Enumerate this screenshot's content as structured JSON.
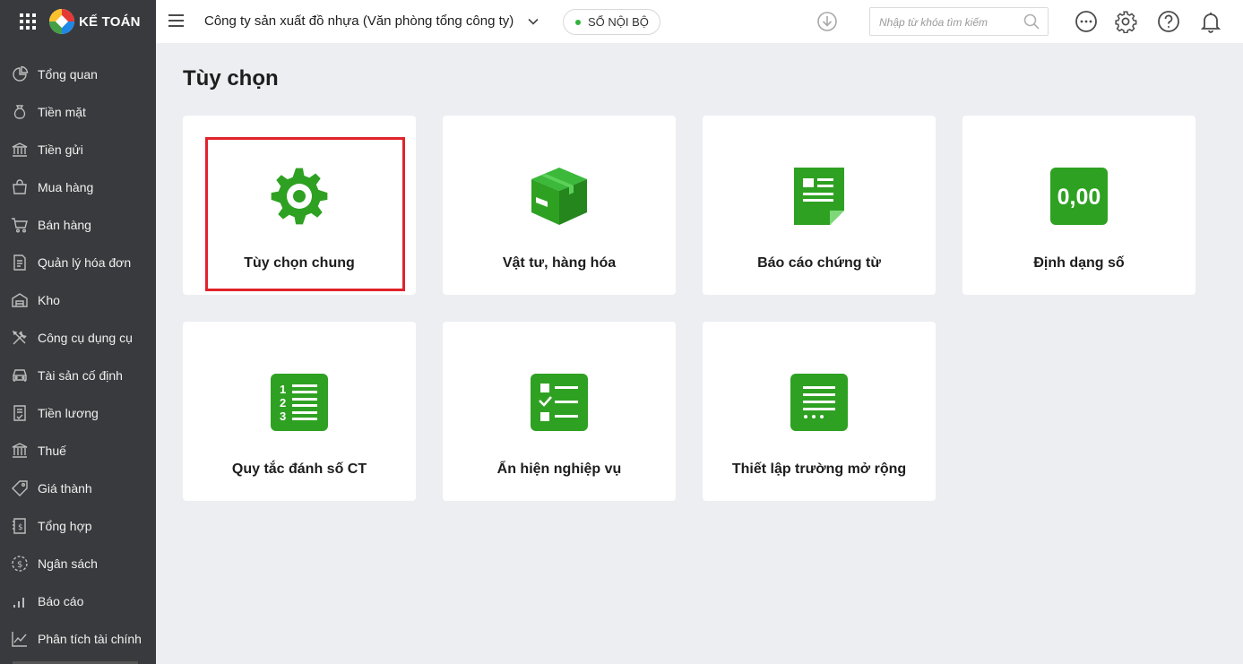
{
  "app": {
    "brand": "KẾ TOÁN"
  },
  "sidebar": {
    "items": [
      {
        "label": "Tổng quan",
        "icon": "dashboard-icon"
      },
      {
        "label": "Tiền mặt",
        "icon": "money-bag-icon"
      },
      {
        "label": "Tiền gửi",
        "icon": "bank-icon"
      },
      {
        "label": "Mua hàng",
        "icon": "shopping-bag-icon"
      },
      {
        "label": "Bán hàng",
        "icon": "cart-icon"
      },
      {
        "label": "Quản lý hóa đơn",
        "icon": "invoice-icon"
      },
      {
        "label": "Kho",
        "icon": "warehouse-icon"
      },
      {
        "label": "Công cụ dụng cụ",
        "icon": "tools-icon"
      },
      {
        "label": "Tài sản cố định",
        "icon": "car-icon"
      },
      {
        "label": "Tiền lương",
        "icon": "salary-icon"
      },
      {
        "label": "Thuế",
        "icon": "tax-building-icon"
      },
      {
        "label": "Giá thành",
        "icon": "price-tag-icon"
      },
      {
        "label": "Tổng hợp",
        "icon": "summary-book-icon"
      },
      {
        "label": "Ngân sách",
        "icon": "budget-coin-icon"
      },
      {
        "label": "Báo cáo",
        "icon": "bar-chart-icon"
      },
      {
        "label": "Phân tích tài chính",
        "icon": "trend-chart-icon"
      }
    ]
  },
  "header": {
    "company": "Công ty sản xuất đồ nhựa (Văn phòng tổng công ty)",
    "ledger": "SỔ NỘI BỘ",
    "search_placeholder": "Nhập từ khóa tìm kiếm"
  },
  "main": {
    "title": "Tùy chọn",
    "cards": [
      {
        "label": "Tùy chọn chung",
        "icon": "gear-icon",
        "selected": true
      },
      {
        "label": "Vật tư, hàng hóa",
        "icon": "box-icon"
      },
      {
        "label": "Báo cáo chứng từ",
        "icon": "document-report-icon"
      },
      {
        "label": "Định dạng số",
        "icon_text": "0,00",
        "icon": "number-format-icon"
      },
      {
        "label": "Quy tắc đánh số CT",
        "icon": "numbered-list-icon"
      },
      {
        "label": "Ẩn hiện nghiệp vụ",
        "icon": "checklist-icon"
      },
      {
        "label": "Thiết lập trường mở rộng",
        "icon": "extended-fields-icon"
      }
    ]
  },
  "colors": {
    "sidebar": "#393a3d",
    "accent_green": "#2ea122",
    "highlight": "#e1232b",
    "background": "#eceef2"
  }
}
